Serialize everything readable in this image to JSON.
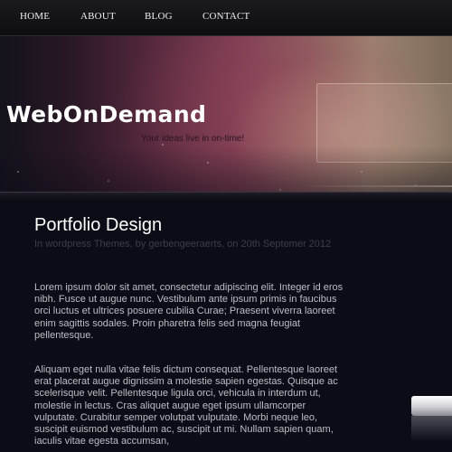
{
  "nav": {
    "items": [
      {
        "label": "HOME"
      },
      {
        "label": "ABOUT"
      },
      {
        "label": "BLOG"
      },
      {
        "label": "CONTACT"
      }
    ]
  },
  "header": {
    "site_title": "WebOnDemand",
    "tagline": "Your ideas live in on-time!"
  },
  "post": {
    "title": "Portfolio Design",
    "meta": "In wordpress Themes, by gerbengeeraerts, on 20th Septemer 2012",
    "paragraphs": [
      "Lorem ipsum dolor sit amet, consectetur adipiscing elit. Integer id eros nibh. Fusce ut augue nunc. Vestibulum ante ipsum primis in faucibus orci luctus et ultrices posuere cubilia Curae; Praesent viverra laoreet enim sagittis sodales. Proin pharetra felis sed magna feugiat pellentesque.",
      "Aliquam eget nulla vitae felis dictum consequat. Pellentesque laoreet erat placerat augue dignissim a molestie sapien egestas. Quisque ac scelerisque velit. Pellentesque ligula orci, vehicula in interdum ut, molestie in lectus. Cras aliquet augue eget ipsum ullamcorper vulputate. Curabitur semper volutpat vulputate. Morbi neque leo, suscipit euismod vestibulum ac, suscipit ut mi. Nullam sapien quam, iaculis vitae egesta accumsan,"
    ]
  },
  "colors": {
    "background": "#0c0c16",
    "nav_background": "#141416",
    "title_text": "#ffffff",
    "meta_text": "#3d3d48",
    "body_text": "#bdbdc6",
    "banner_accent": "#7c3d52"
  }
}
